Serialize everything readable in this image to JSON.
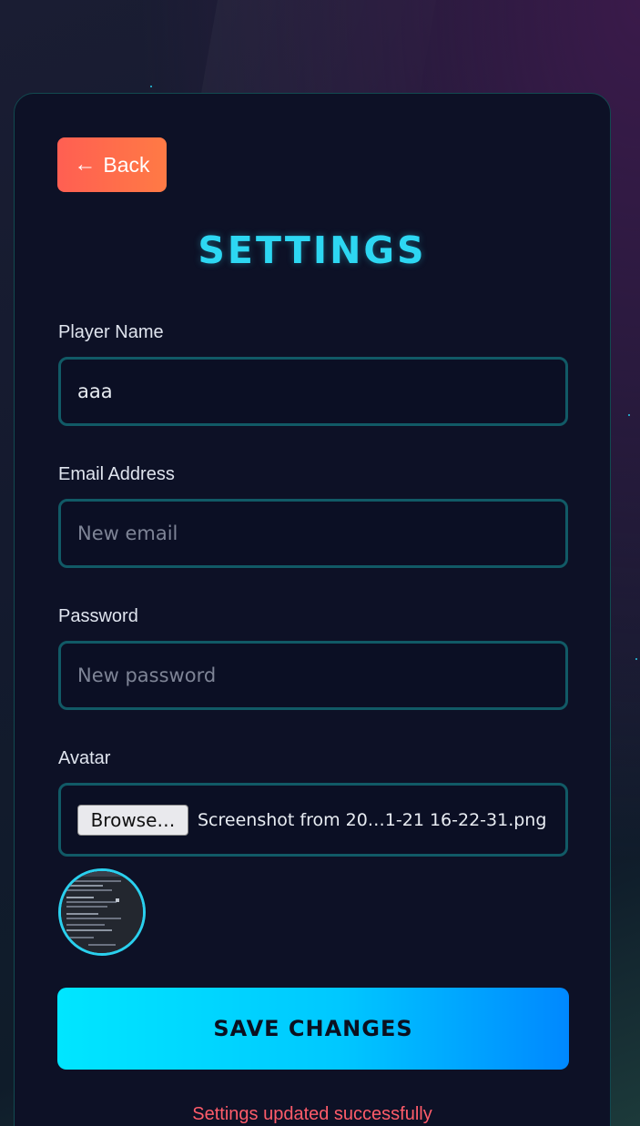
{
  "header": {
    "back_label": "Back",
    "title": "SETTINGS"
  },
  "form": {
    "player_name": {
      "label": "Player Name",
      "value": "aaa"
    },
    "email": {
      "label": "Email Address",
      "placeholder": "New email"
    },
    "password": {
      "label": "Password",
      "placeholder": "New password"
    },
    "avatar": {
      "label": "Avatar",
      "browse_label": "Browse…",
      "file_name": "Screenshot from 20…1-21 16-22-31.png"
    },
    "save_label": "SAVE CHANGES"
  },
  "status": {
    "message": "Settings updated successfully"
  },
  "colors": {
    "accent": "#2dd7f2",
    "back_button": "#ff6a4d",
    "save_button": "#00d0ff",
    "status_text": "#ff5c6a",
    "card_background": "#0d1126"
  },
  "icons": {
    "back": "arrow-left-icon"
  }
}
